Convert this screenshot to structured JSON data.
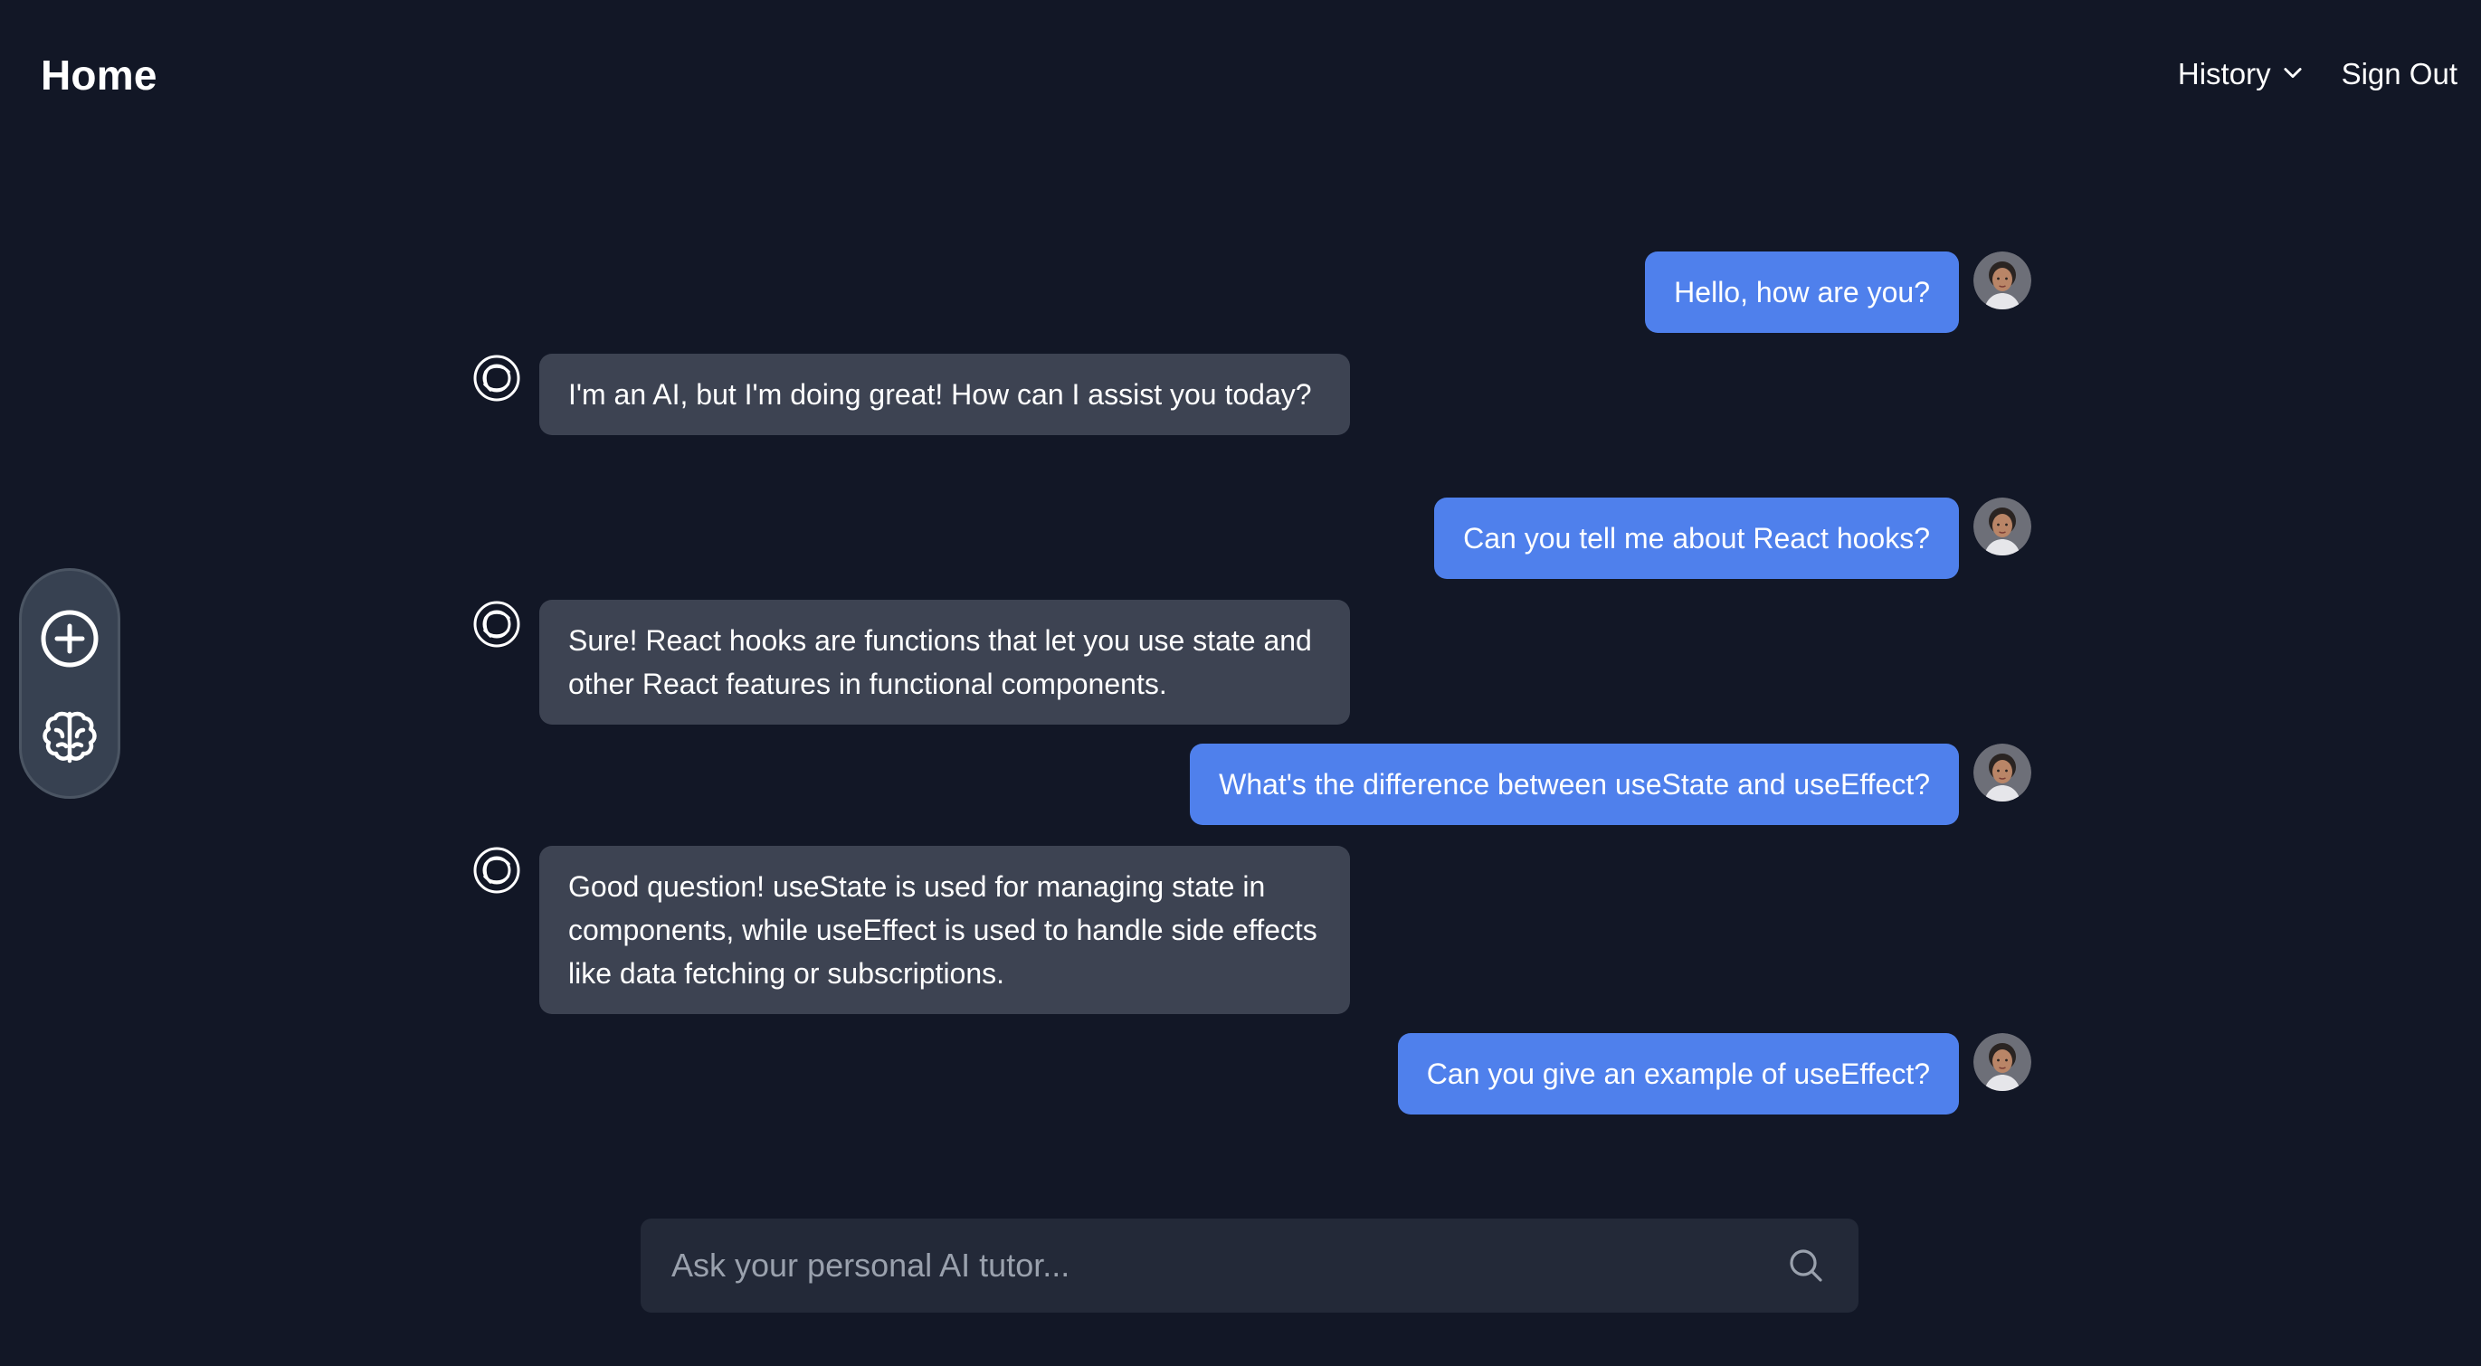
{
  "header": {
    "title": "Home",
    "nav": {
      "history_label": "History",
      "signout_label": "Sign Out"
    }
  },
  "sidebar": {
    "buttons": [
      {
        "icon": "plus-circle-icon"
      },
      {
        "icon": "brain-icon"
      }
    ]
  },
  "messages": [
    {
      "role": "user",
      "text": "Hello, how are you?"
    },
    {
      "role": "assistant",
      "text": "I'm an AI, but I'm doing great! How can I assist you today?"
    },
    {
      "role": "user",
      "text": "Can you tell me about React hooks?"
    },
    {
      "role": "assistant",
      "text": "Sure! React hooks are functions that let you use state and other React features in functional components."
    },
    {
      "role": "user",
      "text": "What's the difference between useState and useEffect?"
    },
    {
      "role": "assistant",
      "text": "Good question! useState is used for managing state in components, while useEffect is used to handle side effects like data fetching or subscriptions."
    },
    {
      "role": "user",
      "text": "Can you give an example of useEffect?"
    }
  ],
  "input": {
    "placeholder": "Ask your personal AI tutor...",
    "value": ""
  },
  "colors": {
    "background": "#121726",
    "user_bubble": "#4f80ec",
    "assistant_bubble": "#3d4352",
    "input_background": "#232938"
  }
}
